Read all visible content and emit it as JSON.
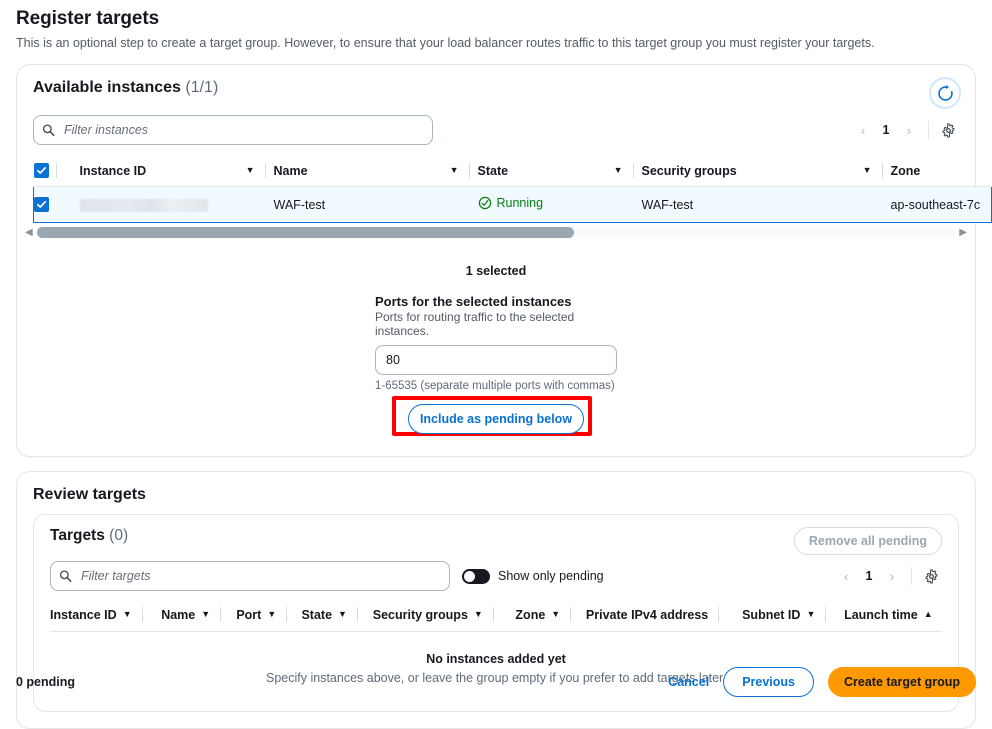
{
  "page": {
    "title": "Register targets",
    "description": "This is an optional step to create a target group. However, to ensure that your load balancer routes traffic to this target group you must register your targets."
  },
  "available_instances": {
    "title": "Available instances",
    "count_label": "(1/1)",
    "refresh_icon": "refresh-icon",
    "filter_placeholder": "Filter instances",
    "pagination": {
      "prev": "‹",
      "page": "1",
      "next": "›"
    },
    "settings_icon": "gear-icon",
    "columns": [
      {
        "label": "Instance ID",
        "sortable": true
      },
      {
        "label": "Name",
        "sortable": true
      },
      {
        "label": "State",
        "sortable": true
      },
      {
        "label": "Security groups",
        "sortable": true
      },
      {
        "label": "Zone",
        "sortable": false
      }
    ],
    "rows": [
      {
        "selected": true,
        "instance_id": "",
        "name": "WAF-test",
        "state": "Running",
        "state_color": "#037f0c",
        "security_groups": "WAF-test",
        "zone": "ap-southeast-7c"
      }
    ],
    "selected_count": "1 selected",
    "ports": {
      "label": "Ports for the selected instances",
      "sublabel": "Ports for routing traffic to the selected instances.",
      "value": "80",
      "hint": "1-65535 (separate multiple ports with commas)"
    },
    "include_button": "Include as pending below",
    "highlight_color": "#ff0000"
  },
  "review_targets": {
    "title": "Review targets",
    "panel": {
      "title": "Targets",
      "count_label": "(0)",
      "remove_all_label": "Remove all pending",
      "filter_placeholder": "Filter targets",
      "toggle_label": "Show only pending",
      "toggle_on": false,
      "pagination": {
        "prev": "‹",
        "page": "1",
        "next": "›"
      },
      "settings_icon": "gear-icon",
      "columns": [
        {
          "label": "Instance ID",
          "sort": "both"
        },
        {
          "label": "Name",
          "sort": "both"
        },
        {
          "label": "Port",
          "sort": "both"
        },
        {
          "label": "State",
          "sort": "both"
        },
        {
          "label": "Security groups",
          "sort": "both"
        },
        {
          "label": "Zone",
          "sort": "both"
        },
        {
          "label": "Private IPv4 address",
          "sort": "none"
        },
        {
          "label": "Subnet ID",
          "sort": "both"
        },
        {
          "label": "Launch time",
          "sort": "asc"
        }
      ],
      "empty_title": "No instances added yet",
      "empty_desc": "Specify instances above, or leave the group empty if you prefer to add targets later."
    }
  },
  "footer": {
    "pending_count": "0 pending",
    "cancel": "Cancel",
    "previous": "Previous",
    "create": "Create target group",
    "create_color": "#ff9900"
  }
}
